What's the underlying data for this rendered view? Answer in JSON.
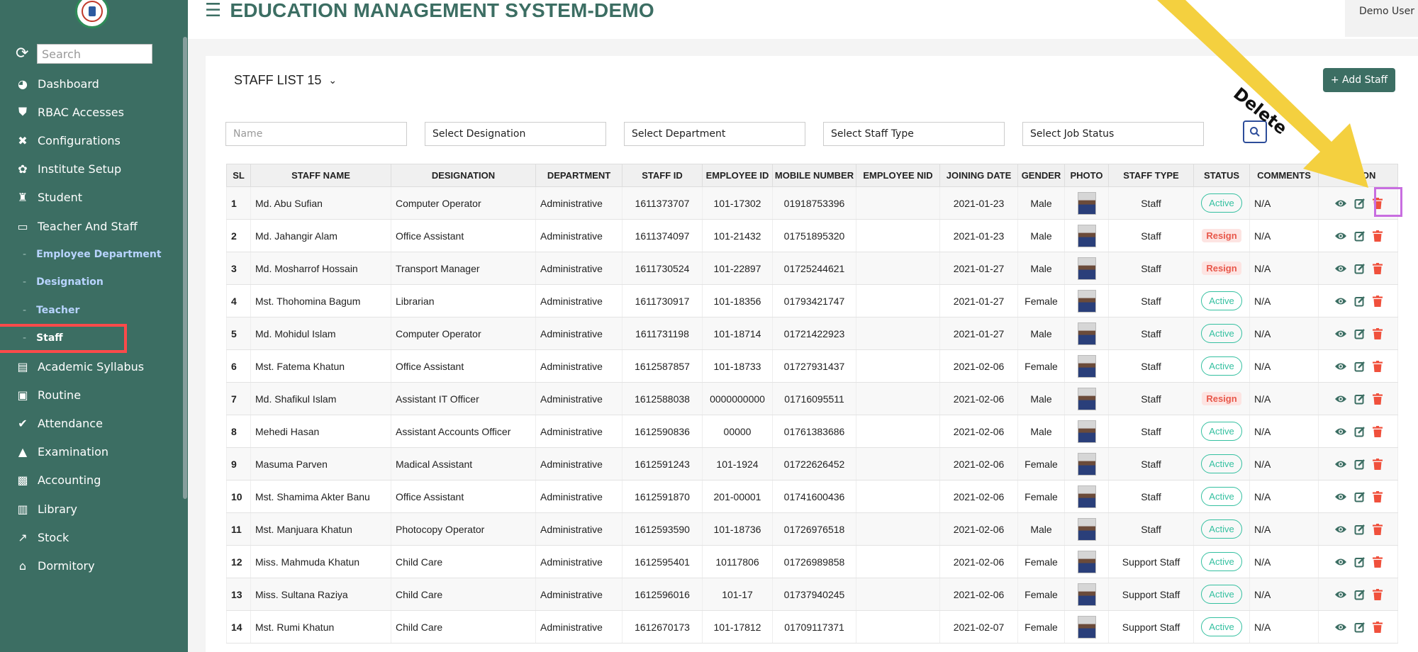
{
  "header": {
    "title": "EDUCATION MANAGEMENT SYSTEM-DEMO",
    "user": "Demo User"
  },
  "sidebar": {
    "search_placeholder": "Search",
    "items": [
      {
        "label": "Dashboard",
        "icon": "palette-icon"
      },
      {
        "label": "RBAC Accesses",
        "icon": "shield-icon"
      },
      {
        "label": "Configurations",
        "icon": "tools-icon"
      },
      {
        "label": "Institute Setup",
        "icon": "gear-icon"
      },
      {
        "label": "Student",
        "icon": "student-icon"
      },
      {
        "label": "Teacher And Staff",
        "icon": "teacher-icon"
      }
    ],
    "subitems": [
      "Employee Department",
      "Designation",
      "Teacher",
      "Staff"
    ],
    "items_after": [
      {
        "label": "Academic Syllabus",
        "icon": "book-icon"
      },
      {
        "label": "Routine",
        "icon": "clipboard-icon"
      },
      {
        "label": "Attendance",
        "icon": "check-circle-icon"
      },
      {
        "label": "Examination",
        "icon": "graduation-cap-icon"
      },
      {
        "label": "Accounting",
        "icon": "money-icon"
      },
      {
        "label": "Library",
        "icon": "open-book-icon"
      },
      {
        "label": "Stock",
        "icon": "chart-line-icon"
      },
      {
        "label": "Dormitory",
        "icon": "home-icon"
      }
    ]
  },
  "card": {
    "title": "STAFF LIST 15",
    "add_button": "+ Add Staff"
  },
  "filters": {
    "name_placeholder": "Name",
    "designation": "Select Designation",
    "department": "Select Department",
    "staff_type": "Select Staff Type",
    "job_status": "Select Job Status"
  },
  "table": {
    "headers": [
      "SL",
      "STAFF NAME",
      "DESIGNATION",
      "DEPARTMENT",
      "STAFF ID",
      "EMPLOYEE ID",
      "MOBILE NUMBER",
      "EMPLOYEE NID",
      "JOINING DATE",
      "GENDER",
      "PHOTO",
      "STAFF TYPE",
      "STATUS",
      "COMMENTS",
      "ACTION"
    ],
    "rows": [
      [
        "1",
        "Md. Abu Sufian",
        "Computer Operator",
        "Administrative",
        "1611373707",
        "101-17302",
        "01918753396",
        "",
        "2021-01-23",
        "Male",
        "Staff",
        "Active",
        "N/A"
      ],
      [
        "2",
        "Md. Jahangir Alam",
        "Office Assistant",
        "Administrative",
        "1611374097",
        "101-21432",
        "01751895320",
        "",
        "2021-01-23",
        "Male",
        "Staff",
        "Resign",
        "N/A"
      ],
      [
        "3",
        "Md. Mosharrof Hossain",
        "Transport Manager",
        "Administrative",
        "1611730524",
        "101-22897",
        "01725244621",
        "",
        "2021-01-27",
        "Male",
        "Staff",
        "Resign",
        "N/A"
      ],
      [
        "4",
        "Mst. Thohomina Bagum",
        "Librarian",
        "Administrative",
        "1611730917",
        "101-18356",
        "01793421747",
        "",
        "2021-01-27",
        "Female",
        "Staff",
        "Active",
        "N/A"
      ],
      [
        "5",
        "Md. Mohidul Islam",
        "Computer Operator",
        "Administrative",
        "1611731198",
        "101-18714",
        "01721422923",
        "",
        "2021-01-27",
        "Male",
        "Staff",
        "Active",
        "N/A"
      ],
      [
        "6",
        "Mst. Fatema Khatun",
        "Office Assistant",
        "Administrative",
        "1612587857",
        "101-18733",
        "01727931437",
        "",
        "2021-02-06",
        "Female",
        "Staff",
        "Active",
        "N/A"
      ],
      [
        "7",
        "Md. Shafikul Islam",
        "Assistant IT Officer",
        "Administrative",
        "1612588038",
        "0000000000",
        "01716095511",
        "",
        "2021-02-06",
        "Male",
        "Staff",
        "Resign",
        "N/A"
      ],
      [
        "8",
        "Mehedi Hasan",
        "Assistant Accounts Officer",
        "Administrative",
        "1612590836",
        "00000",
        "01761383686",
        "",
        "2021-02-06",
        "Male",
        "Staff",
        "Active",
        "N/A"
      ],
      [
        "9",
        "Masuma Parven",
        "Madical Assistant",
        "Administrative",
        "1612591243",
        "101-1924",
        "01722626452",
        "",
        "2021-02-06",
        "Female",
        "Staff",
        "Active",
        "N/A"
      ],
      [
        "10",
        "Mst. Shamima Akter Banu",
        "Office Assistant",
        "Administrative",
        "1612591870",
        "201-00001",
        "01741600436",
        "",
        "2021-02-06",
        "Female",
        "Staff",
        "Active",
        "N/A"
      ],
      [
        "11",
        "Mst. Manjuara Khatun",
        "Photocopy Operator",
        "Administrative",
        "1612593590",
        "101-18736",
        "01726976518",
        "",
        "2021-02-06",
        "Male",
        "Staff",
        "Active",
        "N/A"
      ],
      [
        "12",
        "Miss. Mahmuda Khatun",
        "Child Care",
        "Administrative",
        "1612595401",
        "10117806",
        "01726989858",
        "",
        "2021-02-06",
        "Female",
        "Support Staff",
        "Active",
        "N/A"
      ],
      [
        "13",
        "Miss. Sultana Raziya",
        "Child Care",
        "Administrative",
        "1612596016",
        "101-17",
        "01737940245",
        "",
        "2021-02-06",
        "Female",
        "Support Staff",
        "Active",
        "N/A"
      ],
      [
        "14",
        "Mst. Rumi Khatun",
        "Child Care",
        "Administrative",
        "1612670173",
        "101-17812",
        "01709117371",
        "",
        "2021-02-07",
        "Female",
        "Support Staff",
        "Active",
        "N/A"
      ]
    ]
  },
  "annotation": {
    "label": "Delete"
  },
  "colors": {
    "brand": "#3c6e63",
    "active": "#34c0a0",
    "resign": "#e8574a",
    "arrow": "#f4d03f",
    "highlight_red": "#ff4a4a",
    "highlight_purple": "#c86ee0"
  }
}
